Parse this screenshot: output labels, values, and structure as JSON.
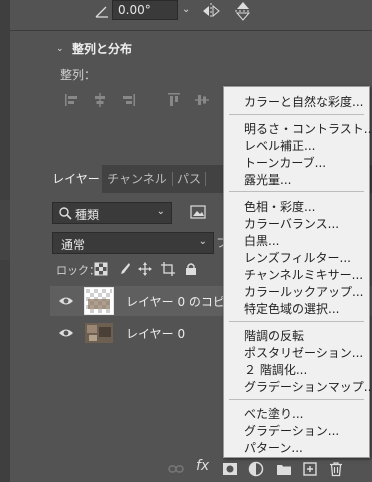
{
  "transform": {
    "angle_value": "0.00°"
  },
  "align_section": {
    "title": "整列と分布",
    "align_label": "整列："
  },
  "layers_panel": {
    "tabs": [
      "レイヤー",
      "チャンネル",
      "パス"
    ],
    "filter_value": "種類",
    "blend_mode": "通常",
    "opacity_label_partial": "フ",
    "lock_label": "ロック："
  },
  "layers": [
    {
      "name": "レイヤー 0 のコピー",
      "selected": true
    },
    {
      "name": "レイヤー 0",
      "selected": false
    }
  ],
  "adjustment_menu": {
    "groups": [
      [
        "カラーと自然な彩度..."
      ],
      [
        "明るさ・コントラスト...",
        "レベル補正...",
        "トーンカーブ...",
        "露光量..."
      ],
      [
        "色相・彩度...",
        "カラーバランス...",
        "白黒...",
        "レンズフィルター...",
        "チャンネルミキサー...",
        "カラールックアップ...",
        "特定色域の選択..."
      ],
      [
        "階調の反転",
        "ポスタリゼーション...",
        "２ 階調化...",
        "グラデーションマップ..."
      ],
      [
        "べた塗り...",
        "グラデーション...",
        "パターン..."
      ]
    ]
  },
  "bottom_bar": {
    "fx_label": "fx"
  },
  "colors": {
    "panel_bg": "#535353",
    "tabbar_bg": "#424242",
    "menu_bg": "#f0f0f0",
    "selected_row": "#5f5f5f"
  }
}
